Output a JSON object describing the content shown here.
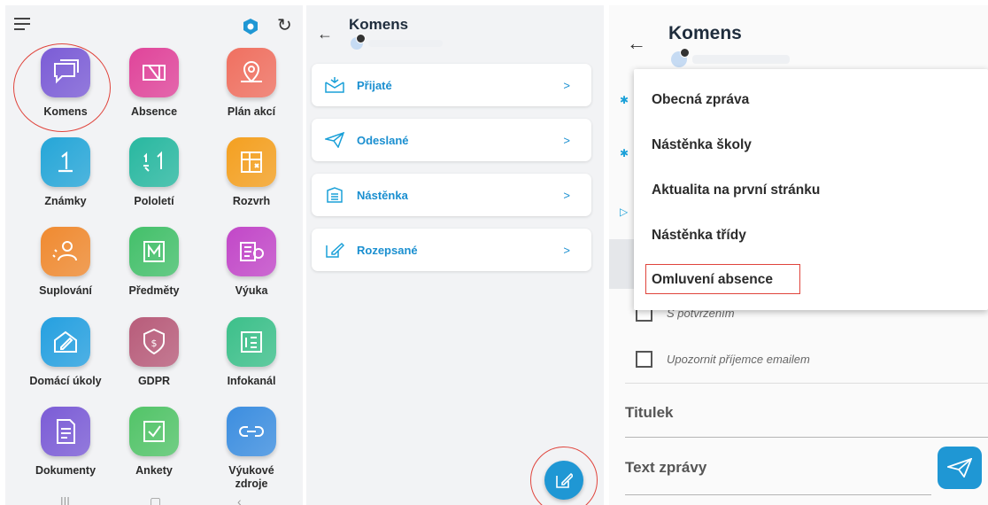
{
  "panel1": {
    "icons": {
      "menu": "hamburger-icon",
      "shield": "shield-icon",
      "refresh": "refresh-icon"
    },
    "apps": [
      {
        "label": "Komens",
        "icon": "chat-icon",
        "color": "#7b5cd6"
      },
      {
        "label": "Absence",
        "icon": "absence-icon",
        "color": "#e0449a"
      },
      {
        "label": "Plán akcí",
        "icon": "map-pin-icon",
        "color": "#f07060"
      },
      {
        "label": "Známky",
        "icon": "grade-one-icon",
        "color": "#25a6d8"
      },
      {
        "label": "Pololetí",
        "icon": "half-year-icon",
        "color": "#28b8a0"
      },
      {
        "label": "Rozvrh",
        "icon": "timetable-icon",
        "color": "#f4a020"
      },
      {
        "label": "Suplování",
        "icon": "substitute-icon",
        "color": "#f08a30"
      },
      {
        "label": "Předměty",
        "icon": "subjects-icon",
        "color": "#43c06a"
      },
      {
        "label": "Výuka",
        "icon": "teaching-icon",
        "color": "#c247c8"
      },
      {
        "label": "Domácí úkoly",
        "icon": "homework-icon",
        "color": "#25a0e0"
      },
      {
        "label": "GDPR",
        "icon": "gdpr-icon",
        "color": "#b85c7a"
      },
      {
        "label": "Infokanál",
        "icon": "infochannel-icon",
        "color": "#3cc08a"
      },
      {
        "label": "Dokumenty",
        "icon": "document-icon",
        "color": "#7b5cd6"
      },
      {
        "label": "Ankety",
        "icon": "poll-icon",
        "color": "#52c468"
      },
      {
        "label": "Výukové zdroje",
        "icon": "link-icon",
        "color": "#3c8ee0"
      }
    ]
  },
  "panel2": {
    "title": "Komens",
    "folders": [
      {
        "label": "Přijaté",
        "icon": "inbox-icon"
      },
      {
        "label": "Odeslané",
        "icon": "send-icon"
      },
      {
        "label": "Nástěnka",
        "icon": "noticeboard-icon"
      },
      {
        "label": "Rozepsané",
        "icon": "draft-edit-icon"
      }
    ],
    "chevron": ">",
    "fab_icon": "compose-icon"
  },
  "panel3": {
    "title": "Komens",
    "dropdown": [
      "Obecná zpráva",
      "Nástěnka školy",
      "Aktualita na první stránku",
      "Nástěnka třídy",
      "Omluvení absence"
    ],
    "checkboxes": [
      "S potvrzením",
      "Upozornit příjemce emailem"
    ],
    "title_field": "Titulek",
    "text_field": "Text zprávy",
    "send_icon": "send-icon"
  },
  "colors": {
    "accent": "#1f97d4",
    "highlight": "#e0443c"
  }
}
